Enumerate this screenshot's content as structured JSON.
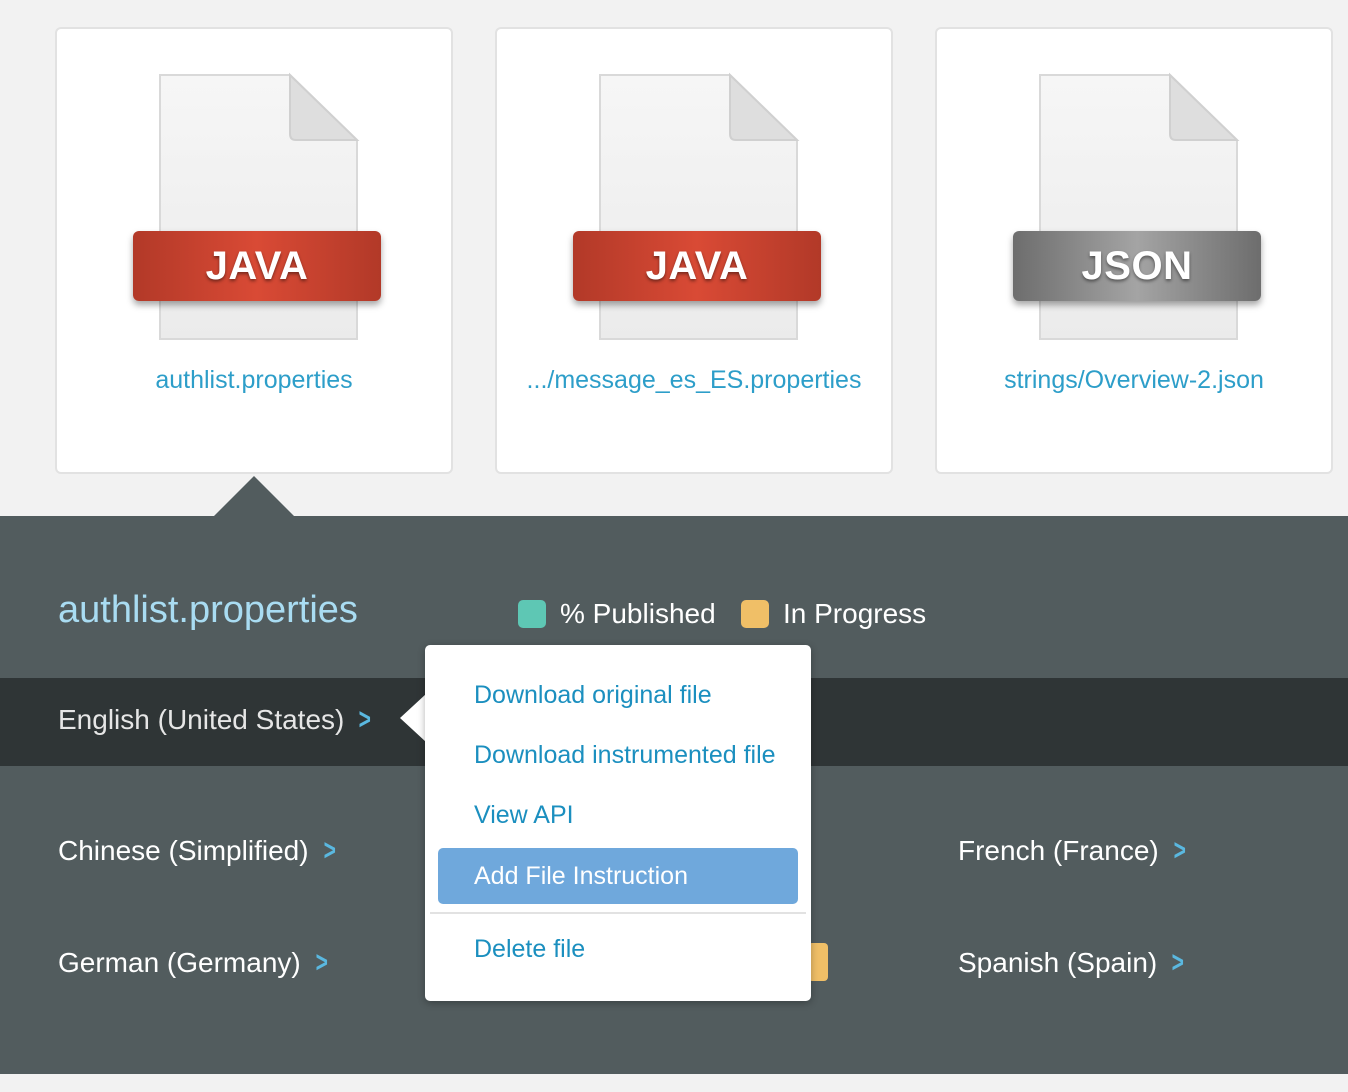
{
  "files": [
    {
      "badge": "JAVA",
      "badge_color": "#c9412f",
      "name": "authlist.properties"
    },
    {
      "badge": "JAVA",
      "badge_color": "#c9412f",
      "name": ".../message_es_ES.properties"
    },
    {
      "badge": "JSON",
      "badge_color": "#8a8a8a",
      "name": "strings/Overview-2.json"
    }
  ],
  "panel": {
    "title": "authlist.properties",
    "legend": [
      {
        "label": "% Published",
        "color": "#5ec7b4"
      },
      {
        "label": "In Progress",
        "color": "#f0bf67"
      }
    ],
    "source_language": "English (United States)",
    "languages": [
      "Chinese (Simplified)",
      "French (France)",
      "German (Germany)",
      "Spanish (Spain)"
    ],
    "chevron": "chevron-right-icon"
  },
  "menu": {
    "items": [
      "Download original file",
      "Download instrumented file",
      "View API",
      "Add File Instruction",
      "Delete file"
    ],
    "active": "Add File Instruction"
  }
}
